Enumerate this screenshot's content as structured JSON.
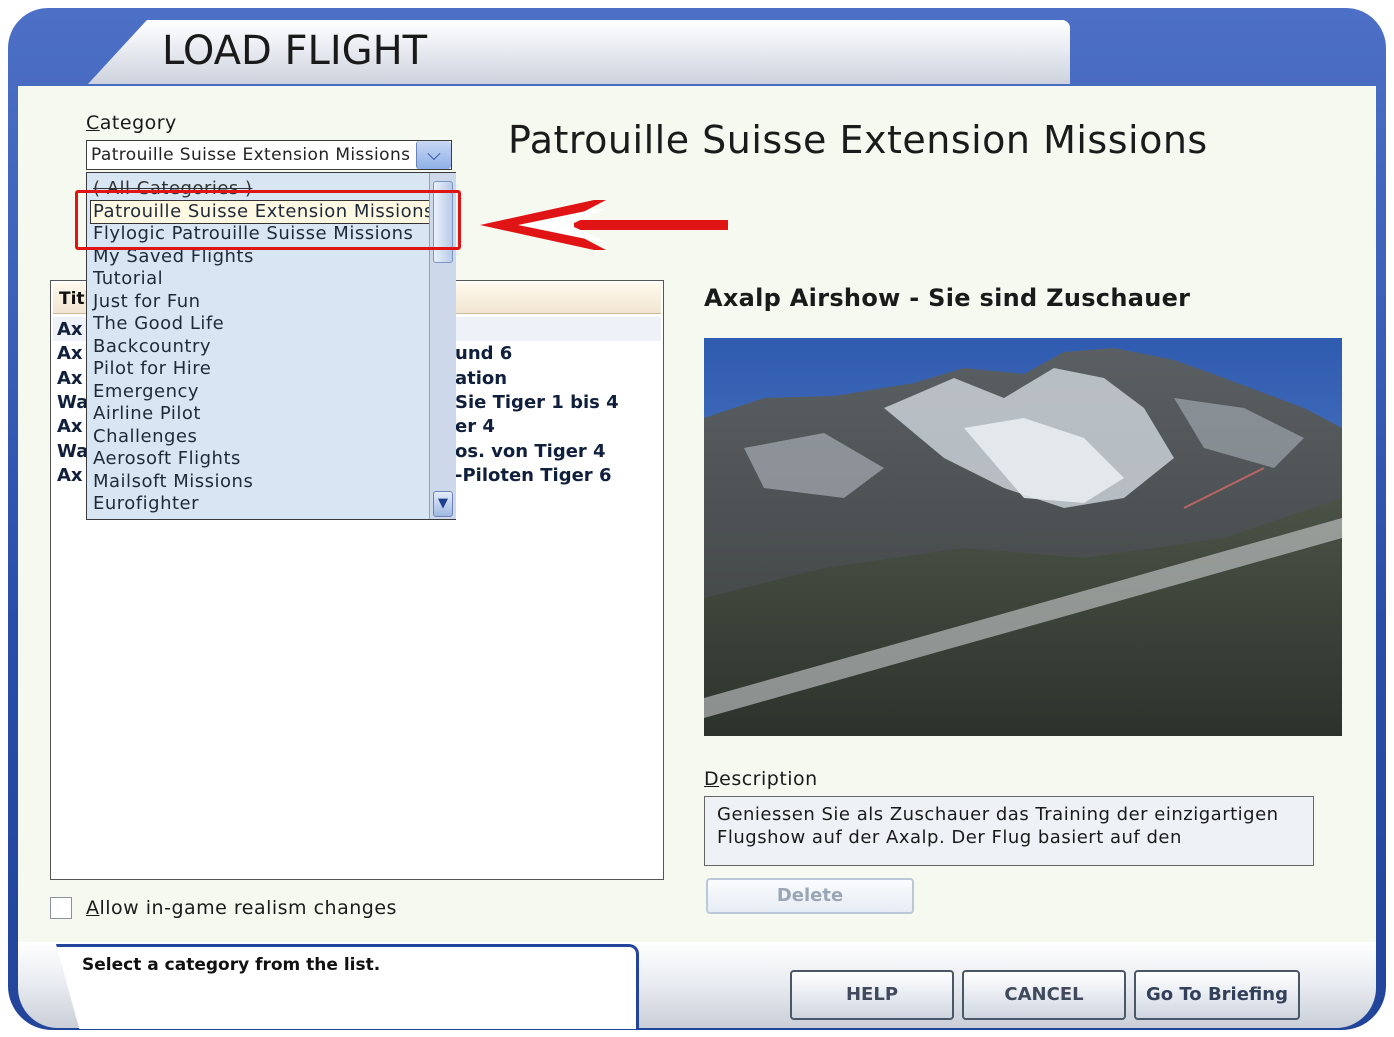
{
  "window": {
    "title": "LOAD FLIGHT"
  },
  "category": {
    "label": "Category",
    "selected_value": "Patrouille Suisse Extension Missions",
    "options": [
      "( All Categories )",
      "Patrouille Suisse Extension Missions",
      "Flylogic Patrouille Suisse Missions",
      "My Saved Flights",
      "Tutorial",
      "Just for Fun",
      "The Good Life",
      "Backcountry",
      "Pilot for Hire",
      "Emergency",
      "Airline Pilot",
      "Challenges",
      "Aerosoft Flights",
      "Mailsoft Missions",
      "Eurofighter"
    ]
  },
  "page_title": "Patrouille Suisse Extension Missions",
  "flight_list": {
    "header": "Title",
    "rows": [
      {
        "left": "Ax",
        "right": ""
      },
      {
        "left": "Ax",
        "right": "und 6"
      },
      {
        "left": "Ax",
        "right": "ation"
      },
      {
        "left": "Wa",
        "right": "Sie Tiger 1 bis 4"
      },
      {
        "left": "Ax",
        "right": "er 4"
      },
      {
        "left": "Wa",
        "right": "os. von Tiger 4"
      },
      {
        "left": "Ax",
        "right": "-Piloten Tiger 6"
      }
    ]
  },
  "selected_flight": {
    "name": "Axalp Airshow - Sie sind Zuschauer",
    "description_label": "Description",
    "description": "Geniessen Sie als Zuschauer das Training der einzigartigen Flugshow auf der Axalp. Der Flug basiert auf den"
  },
  "delete_label": "Delete",
  "realism_label": "Allow in-game realism changes",
  "realism_checked": false,
  "status": "Select a category from the list.",
  "buttons": {
    "help": "HELP",
    "cancel": "CANCEL",
    "briefing": "Go To Briefing"
  },
  "colors": {
    "frame_blue": "#2a4ea8",
    "annotation_red": "#e01414",
    "dropdown_bg": "#d8e6f4"
  },
  "icons": {
    "dropdown": "chevron-down-icon",
    "scroll_down": "chevron-down-icon",
    "annotation": "red-arrow-icon"
  }
}
